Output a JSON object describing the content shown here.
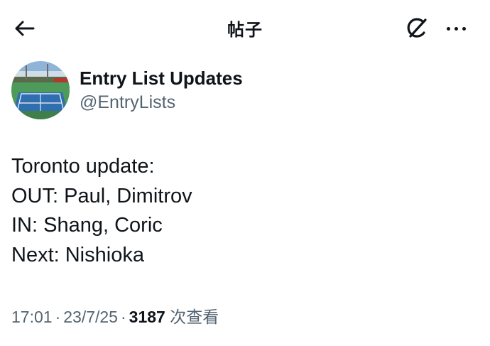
{
  "header": {
    "title": "帖子",
    "back_icon": "arrow-left-icon",
    "grok_icon": "grok-icon",
    "more_icon": "more-horizontal-icon"
  },
  "author": {
    "display_name": "Entry List Updates",
    "handle": "@EntryLists",
    "avatar": "tennis-court-photo"
  },
  "post": {
    "lines": [
      "Toronto update:",
      "OUT: Paul, Dimitrov",
      "IN: Shang, Coric",
      "Next: Nishioka"
    ]
  },
  "meta": {
    "time": "17:01",
    "date": "23/7/25",
    "separator": "·",
    "views_count": "3187",
    "views_label": "次查看"
  }
}
